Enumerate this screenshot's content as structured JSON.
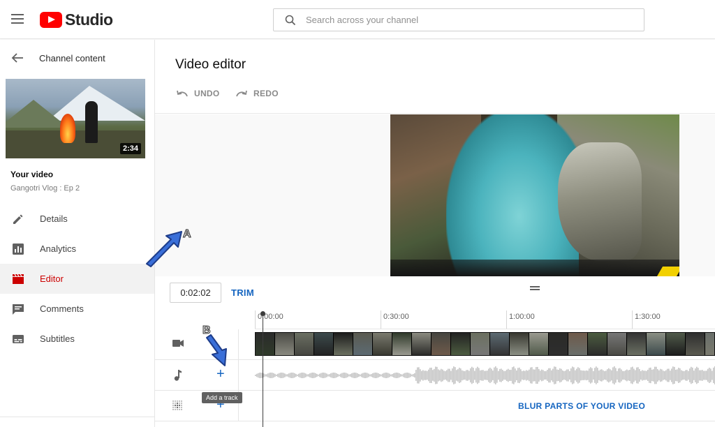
{
  "app": {
    "name": "Studio"
  },
  "search": {
    "placeholder": "Search across your channel"
  },
  "sidebar": {
    "back_label": "Channel content",
    "video": {
      "duration": "2:34",
      "heading": "Your video",
      "title": "Gangotri Vlog : Ep 2"
    },
    "items": [
      {
        "label": "Details",
        "icon": "pencil-icon"
      },
      {
        "label": "Analytics",
        "icon": "analytics-icon"
      },
      {
        "label": "Editor",
        "icon": "clapperboard-icon",
        "active": true
      },
      {
        "label": "Comments",
        "icon": "comment-icon"
      },
      {
        "label": "Subtitles",
        "icon": "subtitles-icon"
      }
    ]
  },
  "editor": {
    "title": "Video editor",
    "undo_label": "UNDO",
    "redo_label": "REDO",
    "current_time": "0:02:02",
    "trim_label": "TRIM",
    "ruler": [
      "0:00:00",
      "0:30:00",
      "1:00:00",
      "1:30:00"
    ],
    "blur_label": "BLUR PARTS OF YOUR VIDEO",
    "tooltip": "Add a track"
  },
  "annotations": {
    "a": "A",
    "b": "B"
  },
  "colors": {
    "accent": "#1565c0",
    "active": "#cc0000",
    "brand": "#ff0000",
    "callout": "#3a6fd8"
  }
}
